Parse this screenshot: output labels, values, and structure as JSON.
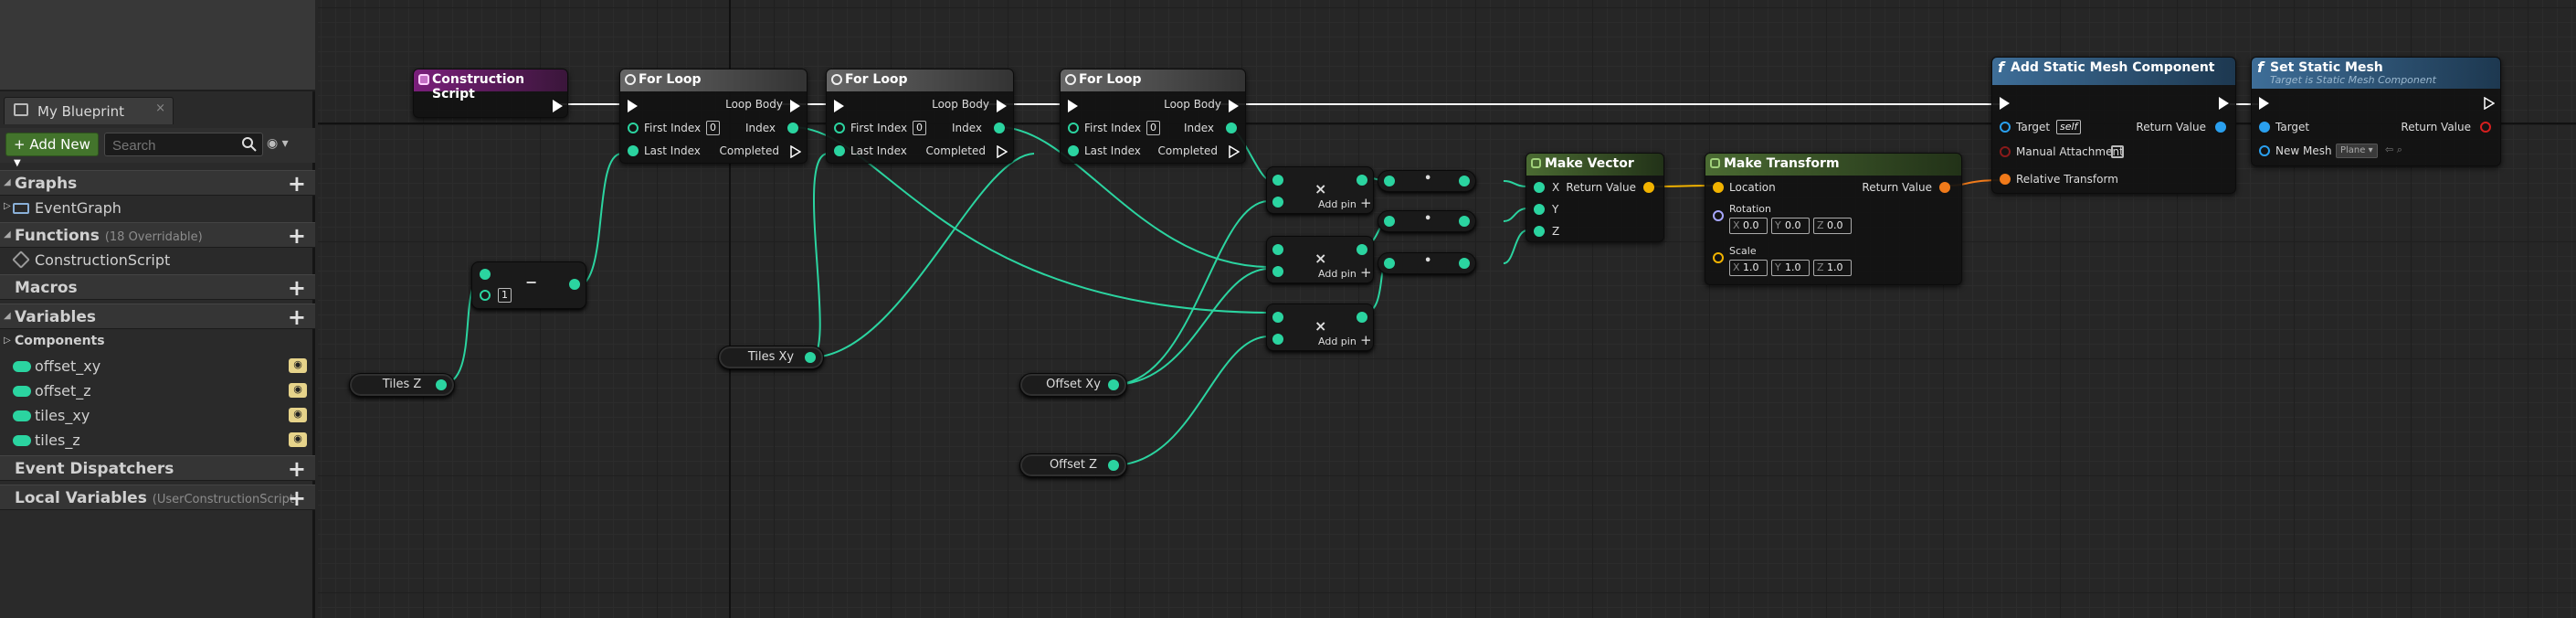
{
  "panel": {
    "tab_label": "My Blueprint",
    "tab_close": "×",
    "add_new_label": "Add New",
    "search_placeholder": "Search",
    "sections": {
      "graphs": "Graphs",
      "functions": "Functions",
      "functions_note": "(18 Overridable)",
      "macros": "Macros",
      "variables": "Variables",
      "event_dispatchers": "Event Dispatchers",
      "local_variables": "Local Variables",
      "local_variables_note": "(UserConstructionScript)"
    },
    "graph_items": [
      "EventGraph"
    ],
    "function_items": [
      "ConstructionScript"
    ],
    "components_label": "Components",
    "variables": [
      "offset_xy",
      "offset_z",
      "tiles_xy",
      "tiles_z"
    ],
    "plus": "+"
  },
  "graph": {
    "construction_script": {
      "title": "Construction Script"
    },
    "for_loops": [
      {
        "title": "For Loop",
        "loop_body": "Loop Body",
        "first_index": "First Index",
        "first_index_value": "0",
        "index": "Index",
        "last_index": "Last Index",
        "completed": "Completed"
      },
      {
        "title": "For Loop",
        "loop_body": "Loop Body",
        "first_index": "First Index",
        "first_index_value": "0",
        "index": "Index",
        "last_index": "Last Index",
        "completed": "Completed"
      },
      {
        "title": "For Loop",
        "loop_body": "Loop Body",
        "first_index": "First Index",
        "first_index_value": "0",
        "index": "Index",
        "last_index": "Last Index",
        "completed": "Completed"
      }
    ],
    "subtract": {
      "symbol": "−",
      "value": "1"
    },
    "multiply_nodes": [
      {
        "symbol": "×",
        "add_pin": "Add pin"
      },
      {
        "symbol": "×",
        "add_pin": "Add pin"
      },
      {
        "symbol": "×",
        "add_pin": "Add pin"
      }
    ],
    "conv_nodes": [
      "•",
      "•",
      "•"
    ],
    "make_vector": {
      "title": "Make Vector",
      "return_value": "Return Value",
      "x": "X",
      "y": "Y",
      "z": "Z"
    },
    "make_transform": {
      "title": "Make Transform",
      "return_value": "Return Value",
      "location": "Location",
      "rotation": "Rotation",
      "rotation_values": [
        "0.0",
        "0.0",
        "0.0"
      ],
      "scale": "Scale",
      "scale_values": [
        "1.0",
        "1.0",
        "1.0"
      ],
      "axes": [
        "X",
        "Y",
        "Z"
      ]
    },
    "add_static_mesh": {
      "title": "Add Static Mesh Component",
      "target": "Target",
      "target_value": "self",
      "return_value": "Return Value",
      "manual_attachment": "Manual Attachment",
      "relative_transform": "Relative Transform",
      "func_icon": "f"
    },
    "set_static_mesh": {
      "title": "Set Static Mesh",
      "subtitle": "Target is Static Mesh Component",
      "target": "Target",
      "return_value": "Return Value",
      "new_mesh": "New Mesh",
      "mesh_value": "Plane",
      "func_icon": "f"
    },
    "var_nodes": {
      "tiles_z": "Tiles Z",
      "tiles_xy": "Tiles Xy",
      "offset_xy": "Offset Xy",
      "offset_z": "Offset Z"
    }
  },
  "colors": {
    "exec": "#ffffff",
    "integer": "#2bd4a0",
    "vector": "#f2b300",
    "transform": "#f07a1a",
    "object": "#2aa0ef",
    "construction_header": "#6a1f6b",
    "function_header": "#2e5f86",
    "pure_header": "#3d5a2a",
    "loop_header": "#555555"
  }
}
